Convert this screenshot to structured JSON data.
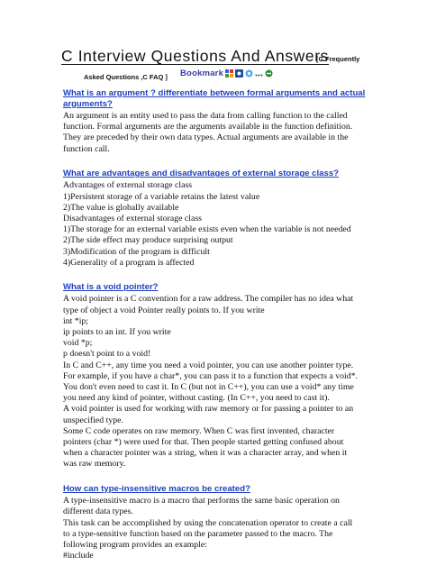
{
  "doc": {
    "title": "C Interview Questions And Answers",
    "title_suffix_1": "[C Frequently",
    "title_suffix_2": "Asked Questions ,C FAQ ]",
    "bookmark_label": "Bookmark"
  },
  "sections": [
    {
      "heading": "What is an argument ? differentiate between formal arguments and actual arguments?",
      "body": [
        "An argument is an entity used to pass the data from calling function to the called",
        "function. Formal arguments are the arguments available in the function definition.",
        "They are preceded by their own data types. Actual arguments are available in the",
        "function call."
      ]
    },
    {
      "heading": "What are advantages and disadvantages of external storage class?",
      "body": [
        "Advantages of external storage class",
        "1)Persistent storage of a variable retains the latest value",
        "2)The value is globally available",
        "Disadvantages of external storage class",
        "1)The storage for an external variable exists even when the variable is not needed",
        "2)The side effect may produce surprising output",
        "3)Modification of the program is difficult",
        "4)Generality of a program is affected"
      ]
    },
    {
      "heading": "What is a void pointer?",
      "body": [
        "A void pointer is a C convention for a raw address. The compiler has no idea what",
        "type of object a void Pointer really points to. If you write",
        "int *ip;",
        "ip points to an int. If you write",
        "void *p;",
        "p doesn't point to a void!",
        "In C and C++, any time you need a void pointer, you can use another pointer type.",
        "For example, if you have a char*, you can pass it to a function that expects a void*.",
        "You don't even need to cast it. In C (but not in C++), you can use a void* any time",
        "you need any kind of pointer, without casting. (In C++, you need to cast it).",
        "A void pointer is used for working with raw memory or for passing a pointer to an",
        "unspecified type.",
        "Some C code operates on raw memory. When C was first invented, character",
        "pointers (char *) were used for that. Then people started getting confused about",
        "when a character pointer was a string, when it was a character array, and when it",
        "was raw memory."
      ]
    },
    {
      "heading": "How can type-insensitive macros be created?",
      "body": [
        "A type-insensitive macro is a macro that performs the same basic operation on",
        "different data types.",
        "This task can be accomplished by using the concatenation operator to create a call",
        "to a type-sensitive function based on the parameter passed to the macro. The",
        "following program provides an example:",
        "#include"
      ]
    }
  ]
}
